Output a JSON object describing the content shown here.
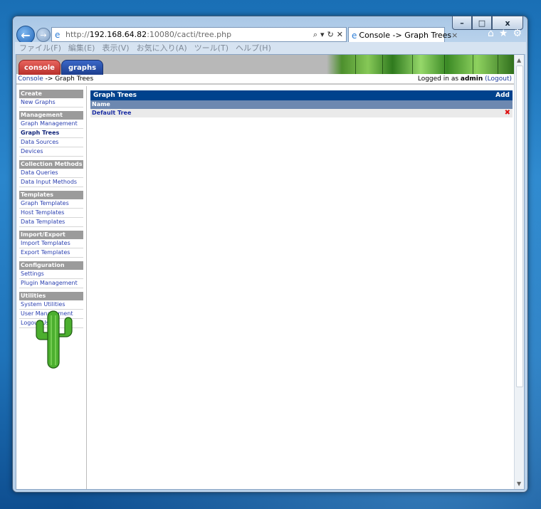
{
  "browser": {
    "url_prefix": "http://",
    "url_host": "192.168.64.82",
    "url_rest": ":10080/cacti/tree.php",
    "tab_title": "Console -> Graph Trees",
    "tab_close": "×",
    "addr_tools": [
      "⌕",
      "▾",
      "↻",
      "✕"
    ],
    "window_controls": {
      "minimize": "–",
      "maximize": "□",
      "close": "x"
    },
    "right_tools": [
      "⌂",
      "★",
      "⚙"
    ],
    "menu": [
      "ファイル(F)",
      "編集(E)",
      "表示(V)",
      "お気に入り(A)",
      "ツール(T)",
      "ヘルプ(H)"
    ]
  },
  "cacti": {
    "tabs": {
      "console": "console",
      "graphs": "graphs"
    },
    "breadcrumb": {
      "root": "Console",
      "sep": " -> ",
      "current": "Graph Trees"
    },
    "login": {
      "prefix": "Logged in as ",
      "user": "admin",
      "logout": "(Logout)"
    },
    "sidebar": [
      {
        "header": "Create",
        "items": [
          "New Graphs"
        ]
      },
      {
        "header": "Management",
        "items": [
          "Graph Management",
          "Graph Trees",
          "Data Sources",
          "Devices"
        ]
      },
      {
        "header": "Collection Methods",
        "items": [
          "Data Queries",
          "Data Input Methods"
        ]
      },
      {
        "header": "Templates",
        "items": [
          "Graph Templates",
          "Host Templates",
          "Data Templates"
        ]
      },
      {
        "header": "Import/Export",
        "items": [
          "Import Templates",
          "Export Templates"
        ]
      },
      {
        "header": "Configuration",
        "items": [
          "Settings",
          "Plugin Management"
        ]
      },
      {
        "header": "Utilities",
        "items": [
          "System Utilities",
          "User Management",
          "Logout User"
        ]
      }
    ],
    "active_item": "Graph Trees",
    "main": {
      "title": "Graph Trees",
      "add": "Add",
      "column": "Name",
      "rows": [
        {
          "name": "Default Tree",
          "delete": "✖"
        }
      ]
    }
  }
}
